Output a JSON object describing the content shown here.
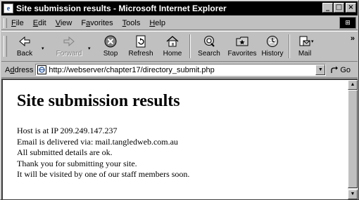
{
  "window": {
    "title": "Site submission results - Microsoft Internet Explorer",
    "title_icon_glyph": "e",
    "minimize_glyph": "_",
    "maximize_glyph": "□",
    "close_glyph": "×"
  },
  "menu": {
    "items": [
      {
        "key": "F",
        "rest": "ile"
      },
      {
        "key": "E",
        "rest": "dit"
      },
      {
        "key": "V",
        "rest": "iew"
      },
      {
        "key": "",
        "pre": "F",
        "key2": "a",
        "rest": "vorites"
      },
      {
        "key": "T",
        "rest": "ools"
      },
      {
        "key": "H",
        "rest": "elp"
      }
    ],
    "logo_glyph": "⊞"
  },
  "toolbar": {
    "back": "Back",
    "forward": "Forward",
    "stop": "Stop",
    "refresh": "Refresh",
    "home": "Home",
    "search": "Search",
    "favorites": "Favorites",
    "history": "History",
    "mail": "Mail",
    "more_glyph": "»",
    "drop_glyph": "▾"
  },
  "address": {
    "label_key": "d",
    "label_pre": "A",
    "label_rest": "dress",
    "url": "http://webserver/chapter17/directory_submit.php",
    "go_label": "Go",
    "drop_glyph": "▼"
  },
  "page": {
    "heading": "Site submission results",
    "lines": [
      "Host is at IP 209.249.147.237",
      "Email is delivered via: mail.tangledweb.com.au",
      "All submitted details are ok.",
      "Thank you for submitting your site.",
      "It will be visited by one of our staff members soon."
    ]
  },
  "scrollbar": {
    "up_glyph": "▲",
    "down_glyph": "▼"
  },
  "colors": {
    "titlebar": "#000000",
    "chrome": "#c0c0c0",
    "content_bg": "#ffffff"
  }
}
